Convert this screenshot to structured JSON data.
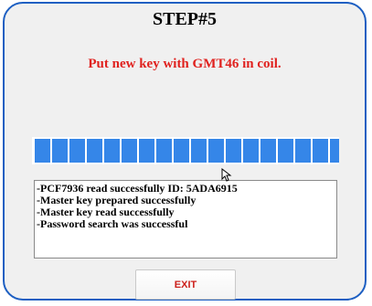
{
  "dialog": {
    "title": "STEP#5",
    "instruction": "Put new key with GMT46 in coil.",
    "instruction_color": "#e0221f",
    "border_color": "#1d5fc2"
  },
  "progress": {
    "value": 1.0,
    "segments": 18,
    "color": "#3586e8"
  },
  "log": {
    "lines": [
      "-PCF7936 read  successfully  ID: 5ADA6915",
      "-Master key prepared successfully",
      "-Master key read successfully",
      "-Password search was successful"
    ]
  },
  "buttons": {
    "exit_label": "EXIT",
    "exit_color": "#cc1f1a"
  },
  "icons": {
    "cursor": "mouse-pointer-icon"
  }
}
